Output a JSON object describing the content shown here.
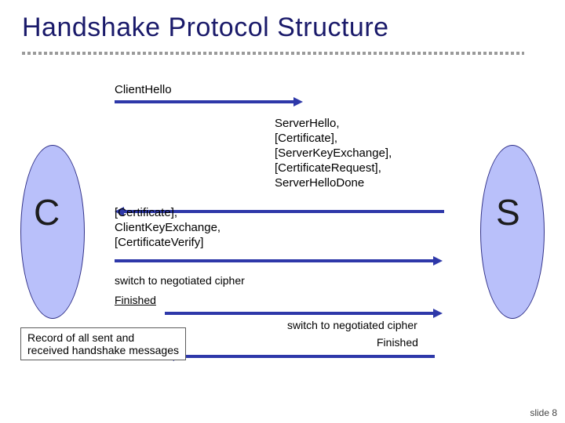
{
  "title": "Handshake Protocol Structure",
  "nodes": {
    "client": "C",
    "server": "S"
  },
  "msg1": "ClientHello",
  "msg2": "ServerHello,\n[Certificate],\n[ServerKeyExchange],\n[CertificateRequest],\nServerHelloDone",
  "msg3": "[Certificate],\nClientKeyExchange,\n[CertificateVerify]",
  "msg4": "switch to negotiated cipher",
  "msg5": "Finished",
  "msg6": "switch to negotiated cipher",
  "msg7": "Finished",
  "note": "Record of all sent and\nreceived handshake messages",
  "footer": "slide 8"
}
